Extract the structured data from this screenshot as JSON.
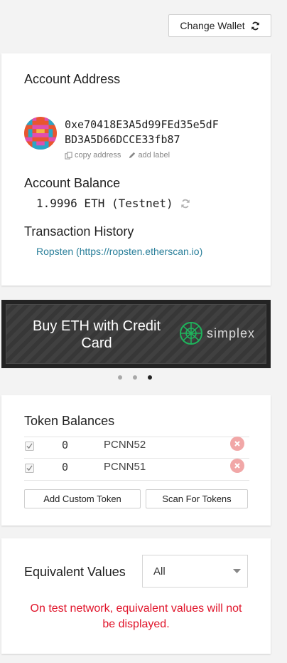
{
  "header": {
    "change_wallet_label": "Change Wallet"
  },
  "account": {
    "address_heading": "Account Address",
    "address_line1": "0xe70418E3A5d99FEd35e5dF",
    "address_line2": "BD3A5D66DCCE33fb87",
    "copy_address_label": "copy address",
    "add_label_label": "add label",
    "balance_heading": "Account Balance",
    "balance_value": "1.9996 ETH (Testnet)",
    "history_heading": "Transaction History",
    "history_link": "Ropsten (https://ropsten.etherscan.io)"
  },
  "promo": {
    "text": "Buy ETH with Credit Card",
    "brand": "simplex",
    "dots": 3,
    "active_dot": 3
  },
  "tokens": {
    "heading": "Token Balances",
    "items": [
      {
        "amount": "0",
        "symbol": "PCNN52"
      },
      {
        "amount": "0",
        "symbol": "PCNN51"
      }
    ],
    "add_custom_label": "Add Custom Token",
    "scan_label": "Scan For Tokens"
  },
  "equivalent": {
    "heading": "Equivalent Values",
    "selected_option": "All",
    "warning": "On test network, equivalent values will not be displayed."
  },
  "colors": {
    "link": "#2a7f9a",
    "warning": "#e0142a",
    "banner_bg": "#3a3a3a",
    "simplex_green": "#1fb35c"
  }
}
